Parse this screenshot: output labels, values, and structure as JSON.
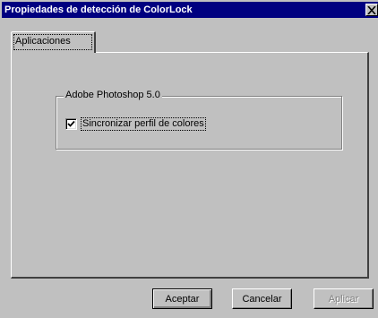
{
  "window": {
    "title": "Propiedades de detección de ColorLock",
    "close_glyph": "✕"
  },
  "tabs": [
    {
      "label": "Aplicaciones",
      "active": true
    }
  ],
  "group": {
    "label": "Adobe Photoshop 5.0",
    "checkbox": {
      "label": "Sincronizar perfil de colores",
      "checked": true
    }
  },
  "buttons": {
    "accept_label": "Aceptar",
    "cancel_label": "Cancelar",
    "apply_label": "Aplicar",
    "apply_enabled": false
  },
  "colors": {
    "titlebar": "#000080",
    "face": "#c0c0c0",
    "disabled_text": "#808080"
  }
}
